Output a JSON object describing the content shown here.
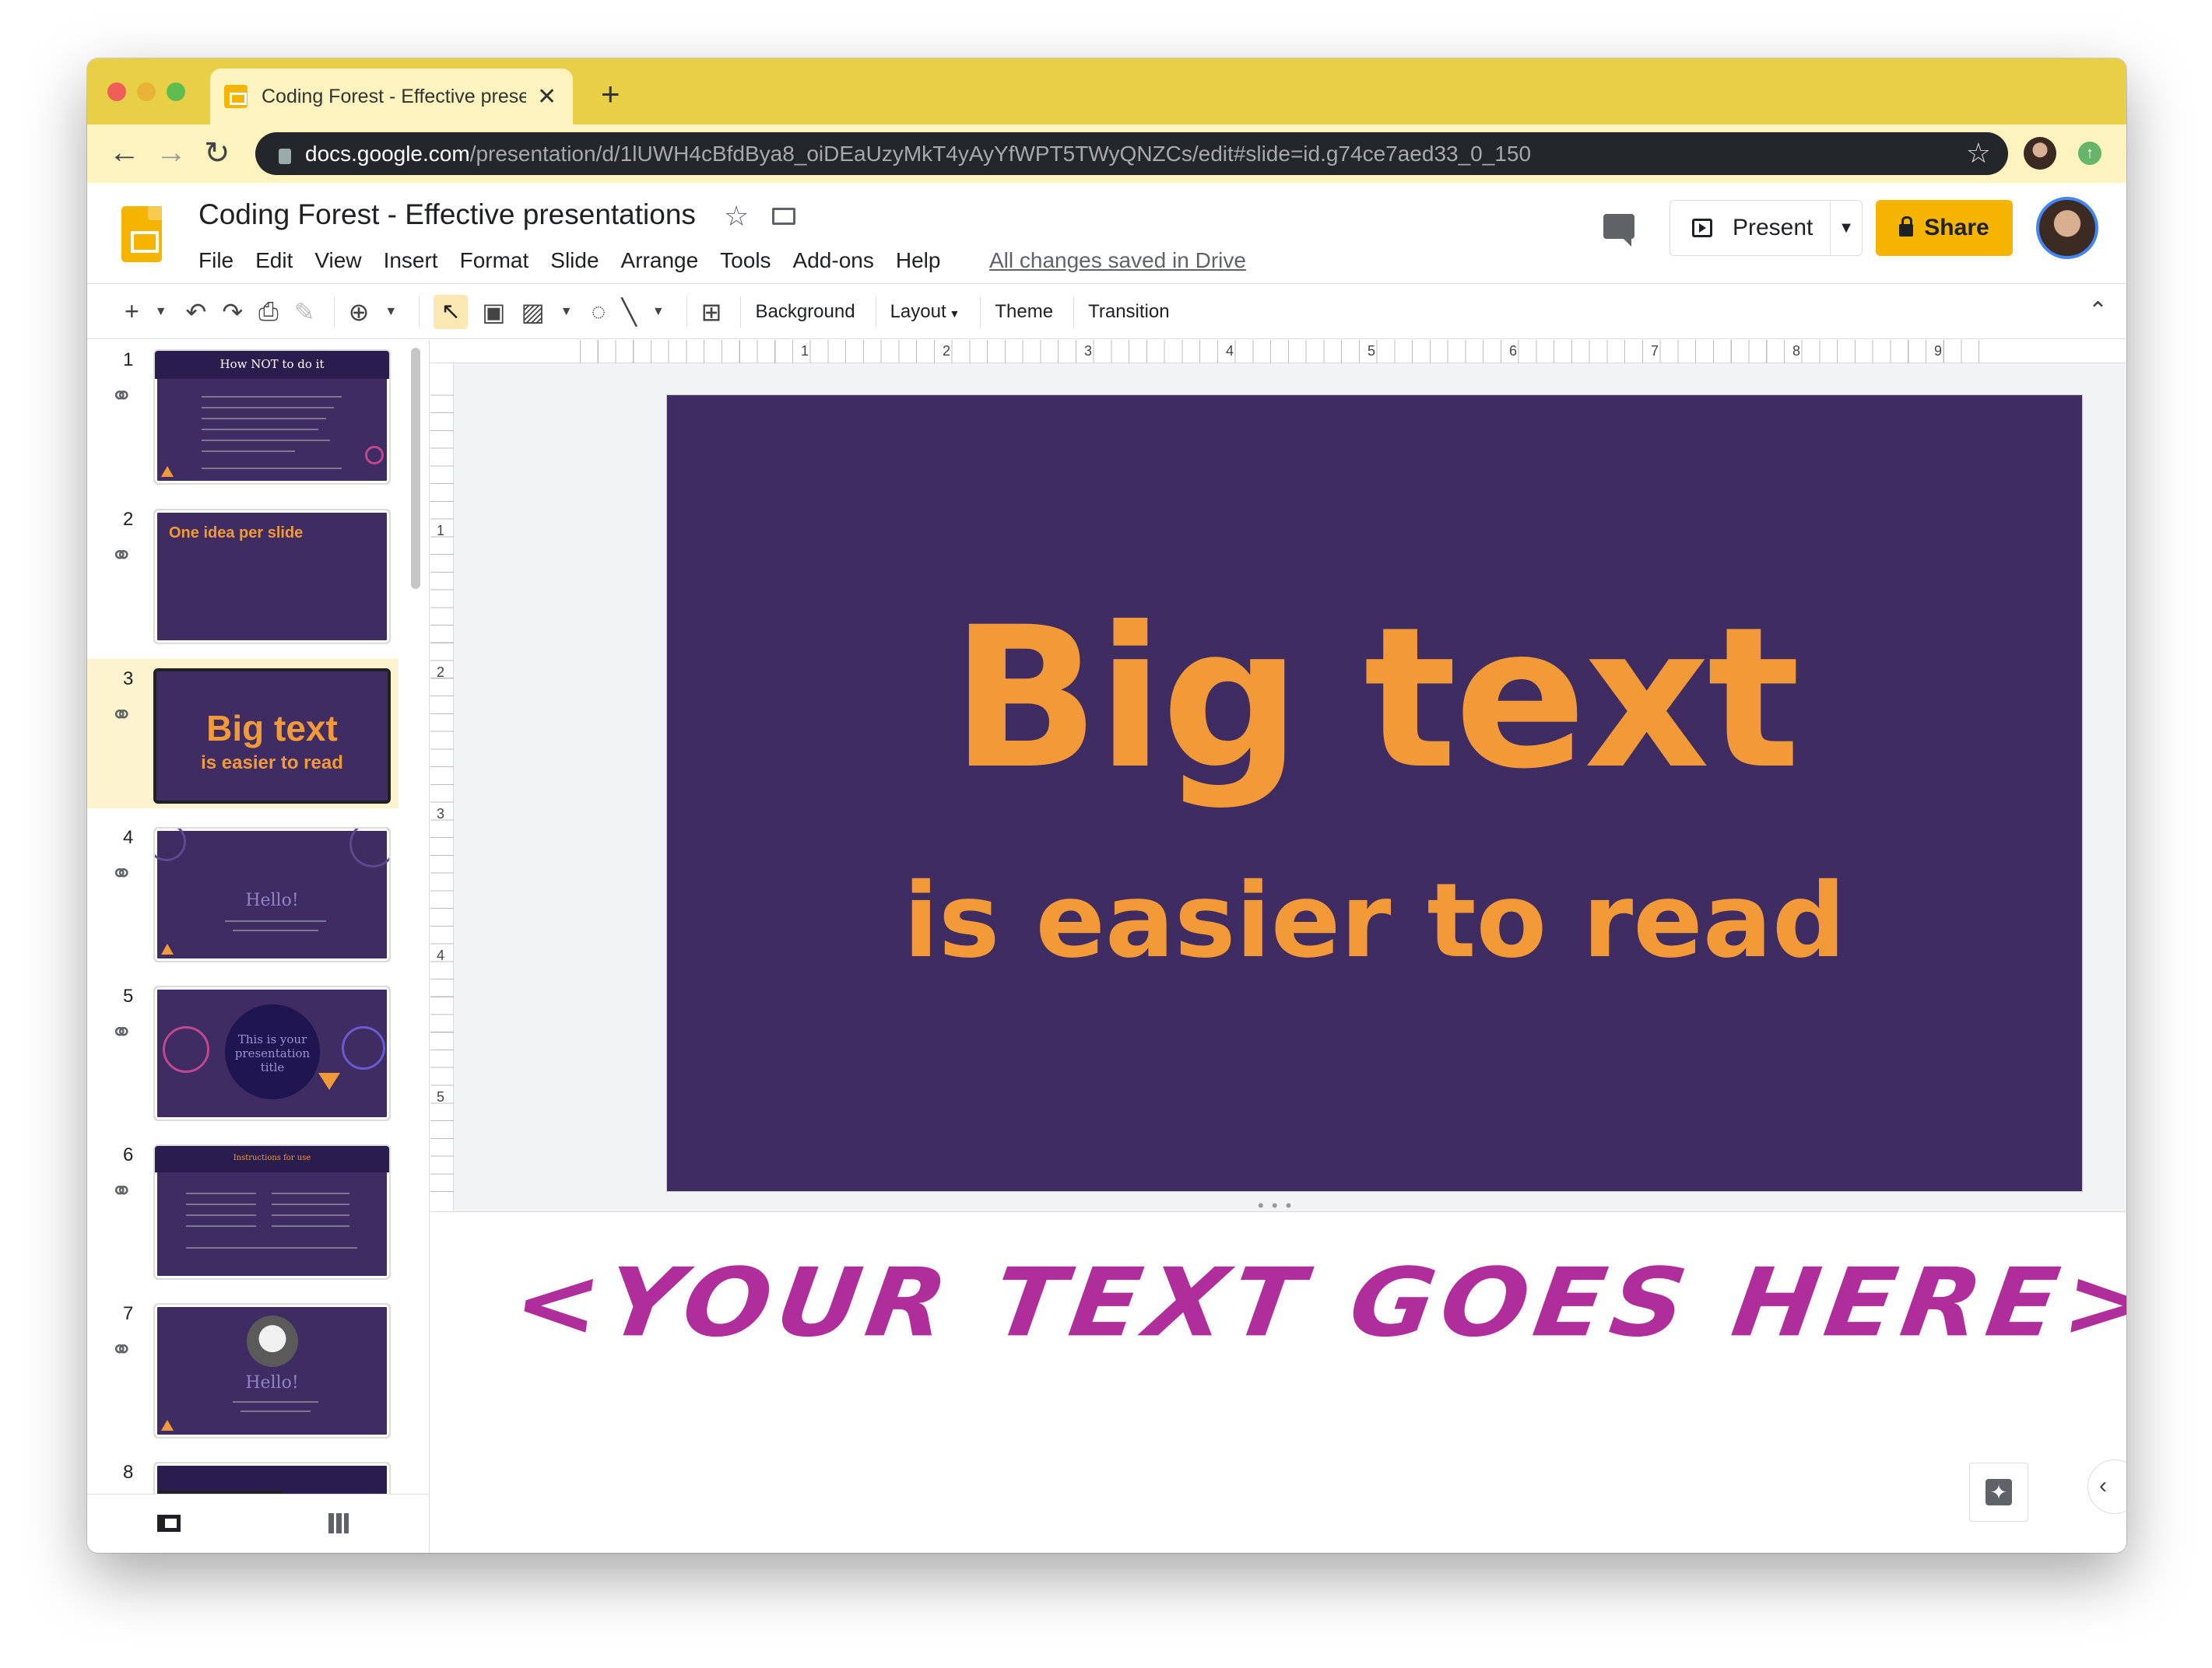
{
  "browser": {
    "tab_title": "Coding Forest - Effective presentations",
    "tab_close": "✕",
    "new_tab": "+",
    "url_host": "docs.google.com",
    "url_path": "/presentation/d/1lUWH4cBfdBya8_oiDEaUzyMkT4yAyYfWPT5TWyQNZCs/edit#slide=id.g74ce7aed33_0_150"
  },
  "header": {
    "doc_title": "Coding Forest - Effective presentations",
    "menu": [
      "File",
      "Edit",
      "View",
      "Insert",
      "Format",
      "Slide",
      "Arrange",
      "Tools",
      "Add-ons",
      "Help"
    ],
    "saved_status": "All changes saved in Drive",
    "present_label": "Present",
    "share_label": "Share"
  },
  "toolbar": {
    "background": "Background",
    "layout": "Layout",
    "theme": "Theme",
    "transition": "Transition"
  },
  "filmstrip": {
    "slides": [
      {
        "num": "1",
        "title": "How NOT to do it"
      },
      {
        "num": "2",
        "title": "One idea per slide"
      },
      {
        "num": "3",
        "title": "Big text",
        "subtitle": "is easier to read"
      },
      {
        "num": "4",
        "title": "Hello!"
      },
      {
        "num": "5",
        "title": "This is your presentation title"
      },
      {
        "num": "6",
        "title": "Instructions for use"
      },
      {
        "num": "7",
        "title": "Hello!"
      },
      {
        "num": "8",
        "title": ""
      }
    ]
  },
  "ruler": {
    "h": [
      "1",
      "2",
      "3",
      "4",
      "5",
      "6",
      "7",
      "8",
      "9"
    ],
    "v": [
      "1",
      "2",
      "3",
      "4",
      "5"
    ]
  },
  "slide": {
    "big_text": "Big text",
    "sub_text": "is easier to read",
    "background": "#3f2c63",
    "accent": "#f29a38"
  },
  "notes": {
    "text": "<YOUR TEXT GOES HERE>",
    "color": "#b02d9c"
  },
  "colors": {
    "chrome_yellow": "#e9cf45",
    "share_yellow": "#f4b400"
  }
}
